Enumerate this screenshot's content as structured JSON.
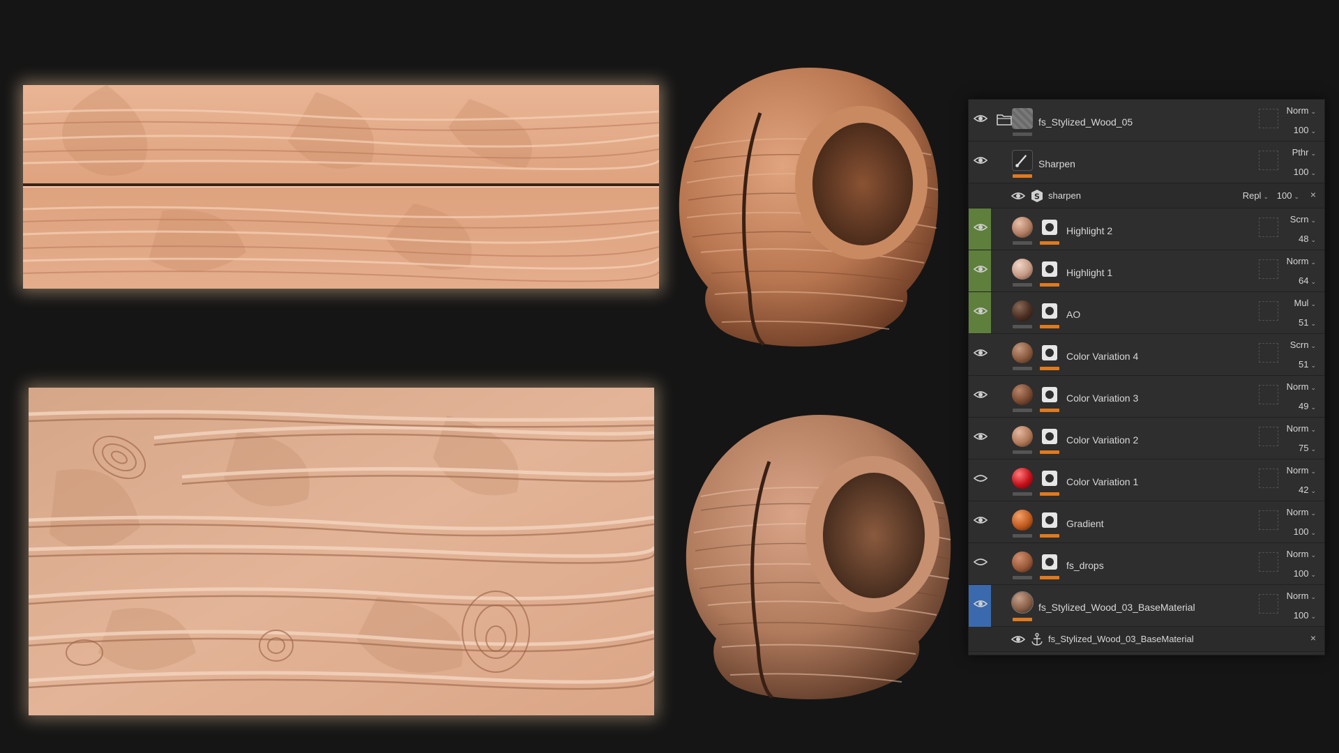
{
  "colors": {
    "panel_bg": "#2e2e2e",
    "accent_orange": "#e07a1f",
    "green_tag": "#5f7f3d",
    "blue_tag": "#3a6aad",
    "wood_light": "#e7b593",
    "wood_mid": "#cf9470",
    "wood_dark": "#8a4f33"
  },
  "layers_panel": {
    "layers": [
      {
        "name": "fs_Stylized_Wood_05",
        "blend": "Norm",
        "opacity": "100",
        "kind": "folder",
        "visible": true,
        "tag": "none"
      },
      {
        "name": "Sharpen",
        "blend": "Pthr",
        "opacity": "100",
        "kind": "filter",
        "visible": true,
        "tag": "none",
        "sub": {
          "name": "sharpen",
          "blend": "Repl",
          "opacity": "100"
        }
      },
      {
        "name": "Highlight 2",
        "blend": "Scrn",
        "opacity": "48",
        "kind": "fill",
        "visible": true,
        "tag": "green",
        "swatch": "#b07d62"
      },
      {
        "name": "Highlight 1",
        "blend": "Norm",
        "opacity": "64",
        "kind": "fill",
        "visible": true,
        "tag": "green",
        "swatch": "#c49a84"
      },
      {
        "name": "AO",
        "blend": "Mul",
        "opacity": "51",
        "kind": "fill",
        "visible": true,
        "tag": "green",
        "swatch": "#4a2e22"
      },
      {
        "name": "Color Variation 4",
        "blend": "Scrn",
        "opacity": "51",
        "kind": "fill",
        "visible": true,
        "tag": "none",
        "swatch": "#8a5a3e"
      },
      {
        "name": "Color Variation 3",
        "blend": "Norm",
        "opacity": "49",
        "kind": "fill",
        "visible": true,
        "tag": "none",
        "swatch": "#7a4a32"
      },
      {
        "name": "Color Variation 2",
        "blend": "Norm",
        "opacity": "75",
        "kind": "fill",
        "visible": true,
        "tag": "none",
        "swatch": "#b07858"
      },
      {
        "name": "Color Variation 1",
        "blend": "Norm",
        "opacity": "42",
        "kind": "fill",
        "visible": false,
        "tag": "none",
        "swatch": "#c4101a"
      },
      {
        "name": "Gradient",
        "blend": "Norm",
        "opacity": "100",
        "kind": "fill",
        "visible": true,
        "tag": "none",
        "swatch": "#c05a1e"
      },
      {
        "name": "fs_drops",
        "blend": "Norm",
        "opacity": "100",
        "kind": "fill",
        "visible": false,
        "tag": "none",
        "swatch": "#9a5a3a"
      },
      {
        "name": "fs_Stylized_Wood_03_BaseMaterial",
        "blend": "Norm",
        "opacity": "100",
        "kind": "base",
        "visible": true,
        "tag": "blue",
        "swatch": "#8a6048",
        "sub": {
          "name": "fs_Stylized_Wood_03_BaseMaterial"
        }
      }
    ]
  }
}
